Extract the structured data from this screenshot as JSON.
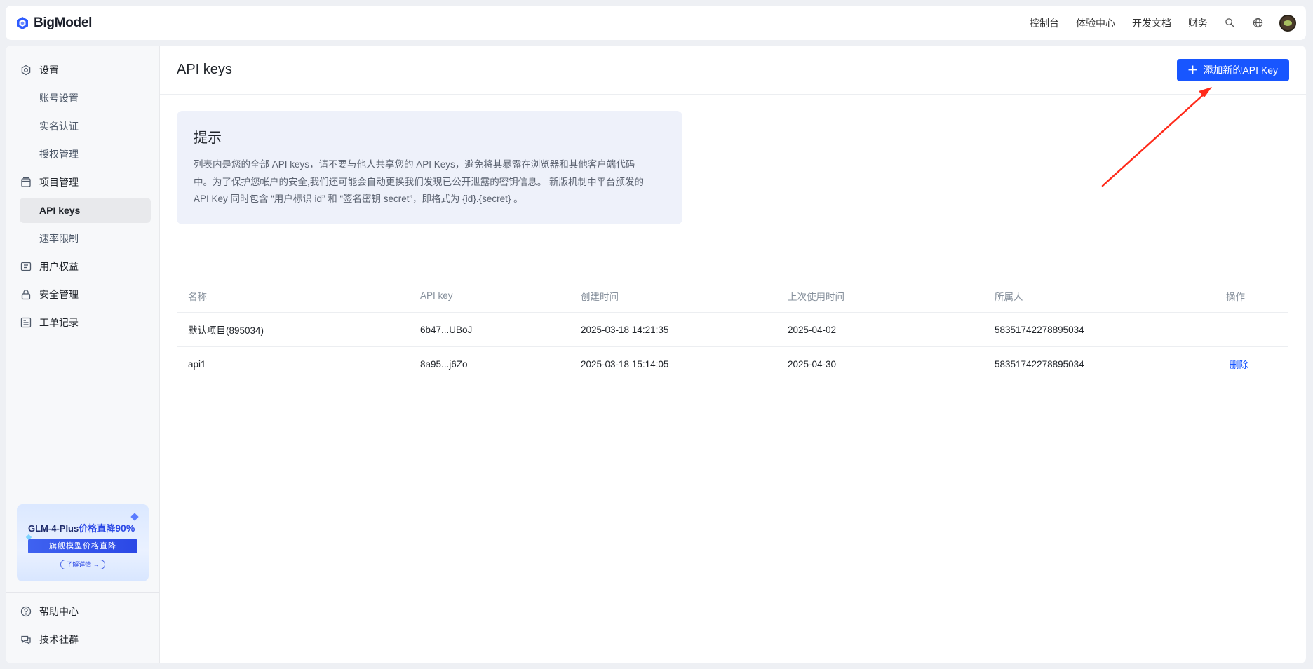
{
  "app": {
    "brand": "BigModel",
    "nav": [
      "控制台",
      "体验中心",
      "开发文档",
      "财务"
    ],
    "icons": [
      "search-icon",
      "globe-icon",
      "avatar"
    ]
  },
  "sidebar": {
    "groups": [
      {
        "label": "设置",
        "icon": "gear-icon",
        "items": [
          "账号设置",
          "实名认证",
          "授权管理"
        ]
      },
      {
        "label": "项目管理",
        "icon": "project-icon",
        "items": [
          "API keys",
          "速率限制"
        ]
      },
      {
        "label": "用户权益",
        "icon": "benefits-icon",
        "items": []
      },
      {
        "label": "安全管理",
        "icon": "lock-icon",
        "items": []
      },
      {
        "label": "工单记录",
        "icon": "ticket-icon",
        "items": []
      }
    ],
    "active_item": "API keys",
    "promo": {
      "title_model": "GLM-4-Plus",
      "title_text": "价格直降",
      "title_pct": "90%",
      "band": "旗舰模型价格直降",
      "button": "了解详情 →"
    },
    "bottom": [
      {
        "label": "帮助中心",
        "icon": "help-icon"
      },
      {
        "label": "技术社群",
        "icon": "chat-icon"
      }
    ]
  },
  "page": {
    "title": "API keys",
    "add_button": "添加新的API Key",
    "tip": {
      "title": "提示",
      "line1": "列表内是您的全部 API keys，请不要与他人共享您的 API Keys，避免将其暴露在浏览器和其他客户端代码",
      "line2": "中。为了保护您帐户的安全,我们还可能会自动更换我们发现已公开泄露的密钥信息。 新版机制中平台颁发的",
      "line3": "API Key 同时包含 “用户标识 id” 和 “签名密钥 secret”，即格式为 {id}.{secret} 。"
    },
    "table": {
      "headers": [
        "名称",
        "API key",
        "创建时间",
        "上次使用时间",
        "所属人",
        "操作"
      ],
      "rows": [
        [
          "默认项目(895034)",
          "6b47...UBoJ",
          "2025-03-18 14:21:35",
          "2025-04-02",
          "58351742278895034",
          ""
        ],
        [
          "api1",
          "8a95...j6Zo",
          "2025-03-18 15:14:05",
          "2025-04-30",
          "58351742278895034",
          "删除"
        ]
      ]
    }
  },
  "colors": {
    "primary": "#1856ff",
    "arrow": "#ff2a1a"
  }
}
